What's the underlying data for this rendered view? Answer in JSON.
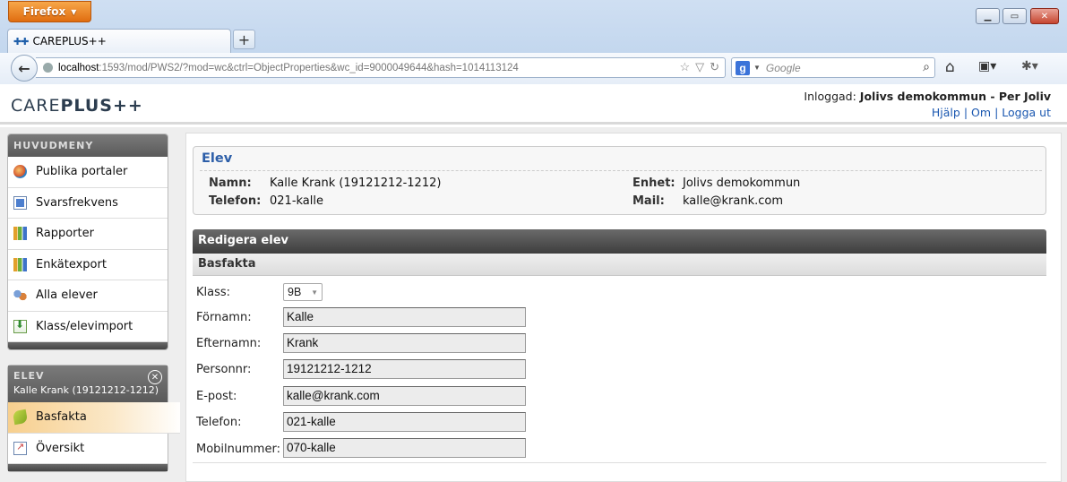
{
  "browser": {
    "menu_label": "Firefox",
    "tab_title": "CAREPLUS++",
    "url_host": "localhost",
    "url_path": ":1593/mod/PWS2/?mod=wc&ctrl=ObjectProperties&wc_id=9000049644&hash=1014113124",
    "search_placeholder": "Google",
    "search_engine_icon": "g",
    "new_tab_label": "+",
    "accent": "#e06d10"
  },
  "header": {
    "logo_care": "CARE",
    "logo_plus": "PLUS",
    "logo_pp": "++",
    "login_label": "Inloggad:",
    "login_user": "Jolivs demokommun - Per Joliv",
    "links": [
      "Hjälp",
      "Om",
      "Logga ut"
    ]
  },
  "mainmenu": {
    "title": "HUVUDMENY",
    "items": [
      {
        "label": "Publika portaler",
        "icon": "globe-icon"
      },
      {
        "label": "Svarsfrekvens",
        "icon": "document-icon"
      },
      {
        "label": "Rapporter",
        "icon": "bar-chart-icon"
      },
      {
        "label": "Enkätexport",
        "icon": "bar-chart-icon"
      },
      {
        "label": "Alla elever",
        "icon": "users-icon"
      },
      {
        "label": "Klass/elevimport",
        "icon": "import-icon"
      }
    ]
  },
  "elevmenu": {
    "title": "ELEV",
    "subtitle": "Kalle Krank (19121212-1212)",
    "items": [
      {
        "label": "Basfakta",
        "icon": "leaf-icon",
        "active": true
      },
      {
        "label": "Översikt",
        "icon": "chart-icon",
        "active": false
      }
    ]
  },
  "elevinfo": {
    "title": "Elev",
    "namn_label": "Namn:",
    "namn_value": "Kalle Krank (19121212-1212)",
    "telefon_label": "Telefon:",
    "telefon_value": "021-kalle",
    "enhet_label": "Enhet:",
    "enhet_value": "Jolivs demokommun",
    "mail_label": "Mail:",
    "mail_value": "kalle@krank.com"
  },
  "edit": {
    "title": "Redigera elev",
    "section": "Basfakta",
    "klass_label": "Klass:",
    "klass_value": "9B",
    "fields": [
      {
        "label": "Förnamn:",
        "value": "Kalle"
      },
      {
        "label": "Efternamn:",
        "value": "Krank"
      },
      {
        "label": "Personnr:",
        "value": "19121212-1212"
      },
      {
        "label": "E-post:",
        "value": "kalle@krank.com"
      },
      {
        "label": "Telefon:",
        "value": "021-kalle"
      },
      {
        "label": "Mobilnummer:",
        "value": "070-kalle"
      }
    ]
  }
}
